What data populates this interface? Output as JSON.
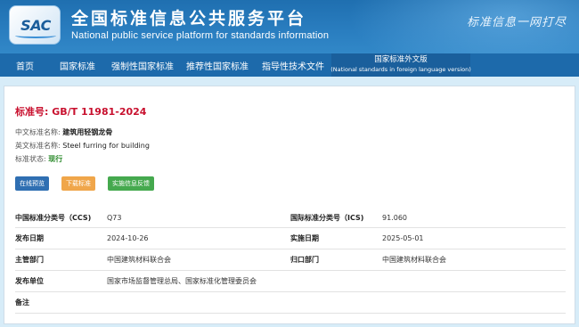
{
  "header": {
    "logo_text": "SAC",
    "title": "全国标准信息公共服务平台",
    "subtitle": "National public service platform  for standards information",
    "slogan": "标准信息一网打尽"
  },
  "nav": {
    "items": [
      {
        "label": "首页"
      },
      {
        "label": "国家标准"
      },
      {
        "label": "强制性国家标准"
      },
      {
        "label": "推荐性国家标准"
      },
      {
        "label": "指导性技术文件"
      }
    ],
    "foreign": {
      "label": "国家标准外文版",
      "sub": "(National standards in foreign language version)"
    }
  },
  "standard": {
    "number_label": "标准号: GB/T 11981-2024",
    "cn_name_label": "中文标准名称:",
    "cn_name": "建筑用轻钢龙骨",
    "en_name_label": "英文标准名称:",
    "en_name": "Steel furring for building",
    "status_label": "标准状态:",
    "status": "现行"
  },
  "buttons": {
    "preview": "在线预览",
    "download": "下载标准",
    "feedback": "实施信息反馈"
  },
  "details": {
    "ccs_label": "中国标准分类号（CCS)",
    "ccs_value": "Q73",
    "ics_label": "国际标准分类号（ICS)",
    "ics_value": "91.060",
    "publish_label": "发布日期",
    "publish_value": "2024-10-26",
    "implement_label": "实施日期",
    "implement_value": "2025-05-01",
    "dept_label": "主管部门",
    "dept_value": "中国建筑材料联合会",
    "owner_label": "归口部门",
    "owner_value": "中国建筑材料联合会",
    "issuer_label": "发布单位",
    "issuer_value": "国家市场监督管理总局、国家标准化管理委员会",
    "remark_label": "备注",
    "remark_value": ""
  }
}
